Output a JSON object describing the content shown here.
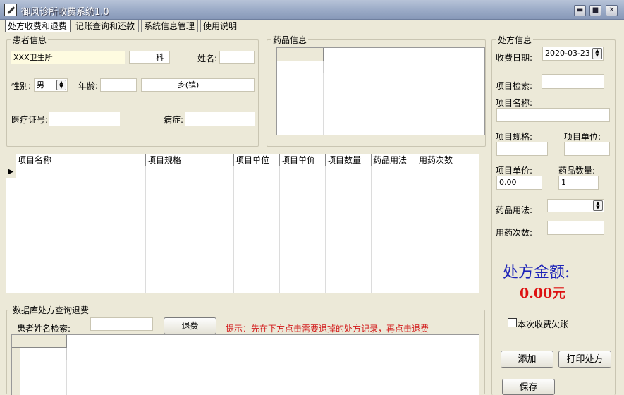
{
  "window": {
    "title": "御风诊所收费系统1.0",
    "minimize": "▬",
    "maximize": "■",
    "close": "✕"
  },
  "menu": {
    "tabs": [
      {
        "label": "处方收费和退费"
      },
      {
        "label": "记账查询和还款"
      },
      {
        "label": "系统信息管理"
      },
      {
        "label": "使用说明"
      }
    ]
  },
  "patient": {
    "group_title": "患者信息",
    "clinic": "XXX卫生所",
    "dept_suffix": "科",
    "name_label": "姓名:",
    "name_value": "",
    "gender_label": "性别:",
    "gender_value": "男",
    "age_label": "年龄:",
    "age_value": "",
    "town_value": "乡(镇)",
    "medical_id_label": "医疗证号:",
    "medical_id_value": "",
    "disease_label": "病症:",
    "disease_value": ""
  },
  "drug_info": {
    "group_title": "药品信息"
  },
  "items_table": {
    "columns": [
      "项目名称",
      "项目规格",
      "项目单位",
      "项目单价",
      "项目数量",
      "药品用法",
      "用药次数"
    ],
    "row_marker": "▶"
  },
  "refund": {
    "group_title": "数据库处方查询退费",
    "search_label": "患者姓名检索:",
    "search_value": "",
    "refund_button": "退费",
    "hint": "提示：先在下方点击需要退掉的处方记录，再点击退费"
  },
  "prescription": {
    "group_title": "处方信息",
    "date_label": "收费日期:",
    "date_value": "2020-03-23",
    "search_label": "项目检索:",
    "search_value": "",
    "name_label": "项目名称:",
    "name_value": "",
    "spec_label": "项目规格:",
    "spec_value": "",
    "unit_label": "项目单位:",
    "unit_value": "",
    "price_label": "项目单价:",
    "price_value": "0.00",
    "qty_label": "药品数量:",
    "qty_value": "1",
    "usage_label": "药品用法:",
    "usage_value": "",
    "times_label": "用药次数:",
    "times_value": "",
    "amount_label": "处方金额:",
    "amount_value": "0.00元",
    "credit_label": "本次收费欠账",
    "add_button": "添加",
    "print_button": "打印处方",
    "save_button": "保存"
  },
  "colors": {
    "accent_blue": "#1d23b8",
    "amount_red": "#d11111",
    "hint_red": "#d21b1b",
    "highlight_yellow": "#fefbe0"
  }
}
